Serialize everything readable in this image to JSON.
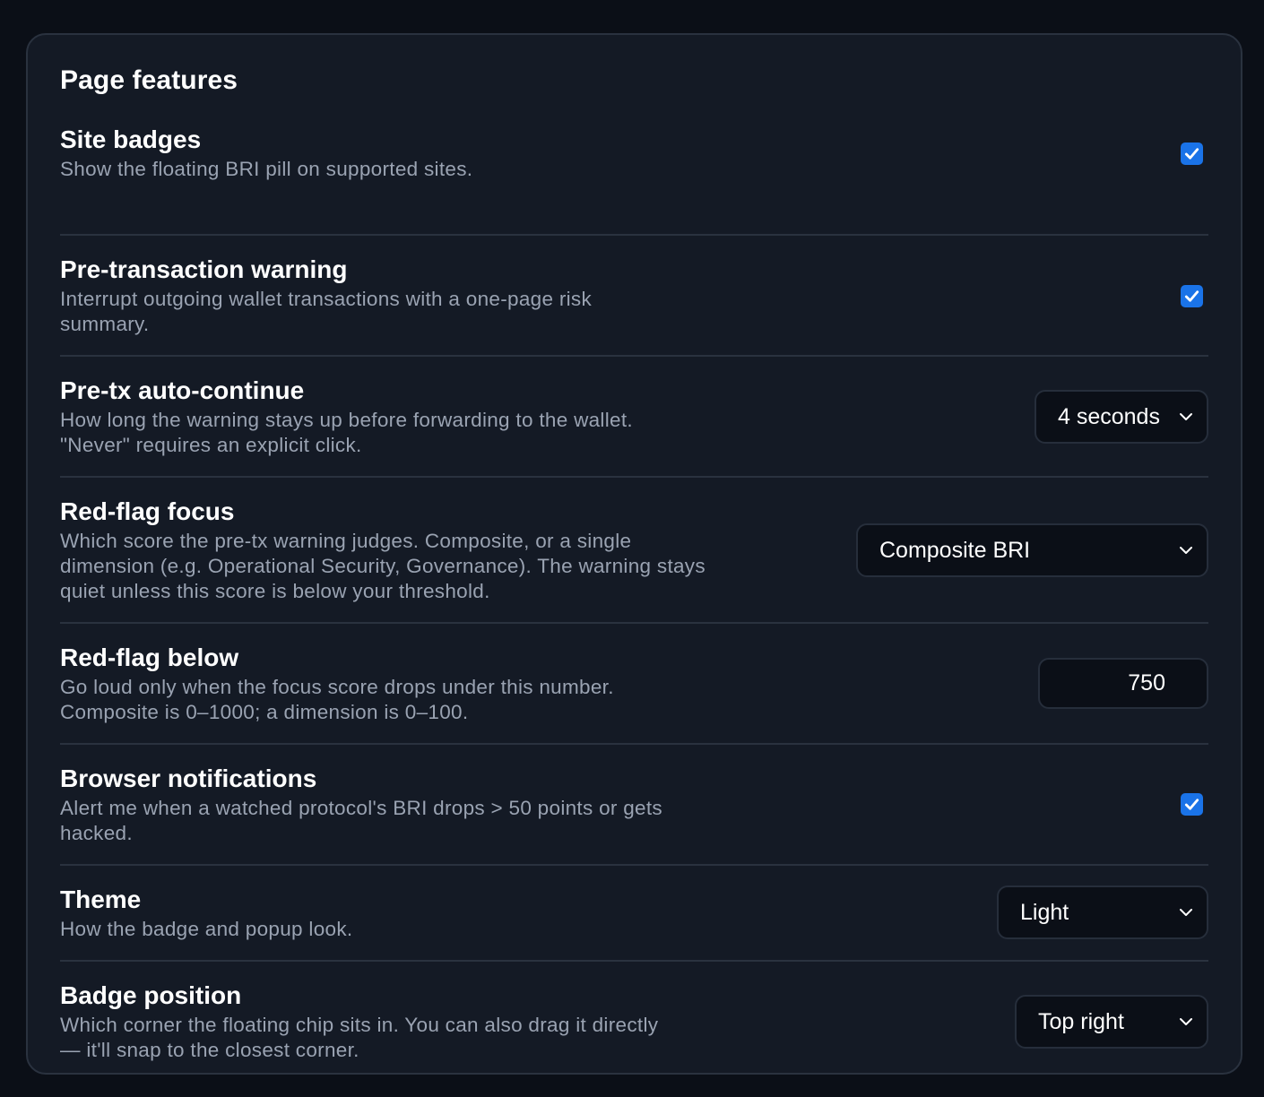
{
  "section": {
    "title": "Page features"
  },
  "rows": {
    "site_badges": {
      "label": "Site badges",
      "description": "Show the floating BRI pill on supported sites.",
      "checked": true
    },
    "pre_tx_warning": {
      "label": "Pre-transaction warning",
      "description": "Interrupt outgoing wallet transactions with a one-page risk summary.",
      "checked": true
    },
    "auto_continue": {
      "label": "Pre-tx auto-continue",
      "description": "How long the warning stays up before forwarding to the wallet. \"Never\" requires an explicit click.",
      "value": "4 seconds"
    },
    "red_flag_focus": {
      "label": "Red-flag focus",
      "description": "Which score the pre-tx warning judges. Composite, or a single dimension (e.g. Operational Security, Governance). The warning stays quiet unless this score is below your threshold.",
      "value": "Composite BRI"
    },
    "red_flag_below": {
      "label": "Red-flag below",
      "description": "Go loud only when the focus score drops under this number. Composite is 0–1000; a dimension is 0–100.",
      "value": "750"
    },
    "browser_notifications": {
      "label": "Browser notifications",
      "description": "Alert me when a watched protocol's BRI drops > 50 points or gets hacked.",
      "checked": true
    },
    "theme": {
      "label": "Theme",
      "description": "How the badge and popup look.",
      "value": "Light"
    },
    "badge_position": {
      "label": "Badge position",
      "description": "Which corner the floating chip sits in. You can also drag it directly — it'll snap to the closest corner.",
      "value": "Top right"
    }
  },
  "icons": {
    "checkbox": "checkmark-icon",
    "select": "chevron-down-icon"
  },
  "colors": {
    "accent": "#1a73e8",
    "background": "#0b0f17",
    "card": "#141a25",
    "divider": "#2a323f",
    "muted_text": "#9aa3b2"
  }
}
